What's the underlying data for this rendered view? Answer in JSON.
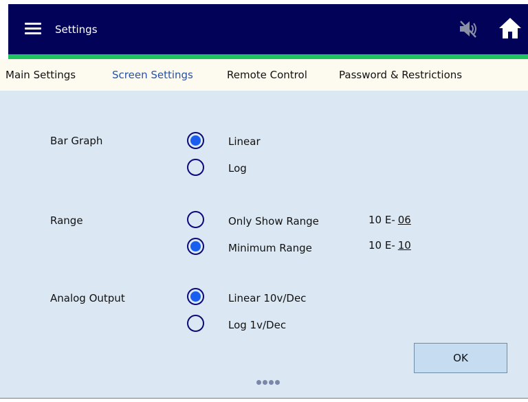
{
  "header": {
    "title": "Settings",
    "menu_icon": "hamburger-menu-icon",
    "mute_icon": "speaker-muted-icon",
    "home_icon": "home-icon"
  },
  "tabs": [
    {
      "label": "Main Settings",
      "active": false
    },
    {
      "label": "Screen Settings",
      "active": true
    },
    {
      "label": "Remote Control",
      "active": false
    },
    {
      "label": "Password & Restrictions",
      "active": false
    }
  ],
  "settings": {
    "bar_graph": {
      "label": "Bar Graph",
      "options": [
        {
          "label": "Linear",
          "selected": true
        },
        {
          "label": "Log",
          "selected": false
        }
      ]
    },
    "range": {
      "label": "Range",
      "options": [
        {
          "label": "Only Show Range",
          "selected": false,
          "exp_prefix": "10 E-",
          "exp_value": "06"
        },
        {
          "label": "Minimum Range",
          "selected": true,
          "exp_prefix": "10 E-",
          "exp_value": "10"
        }
      ]
    },
    "analog_output": {
      "label": "Analog Output",
      "options": [
        {
          "label": "Linear 10v/Dec",
          "selected": true
        },
        {
          "label": "Log 1v/Dec",
          "selected": false
        }
      ]
    }
  },
  "ok_label": "OK",
  "pager": {
    "pages": 4
  },
  "colors": {
    "titlebar": "#020258",
    "accent_bar": "#1fc35f",
    "active_tab": "#2551a8",
    "content_bg": "#dbe8f3",
    "radio_fill": "#1a5ef0"
  }
}
